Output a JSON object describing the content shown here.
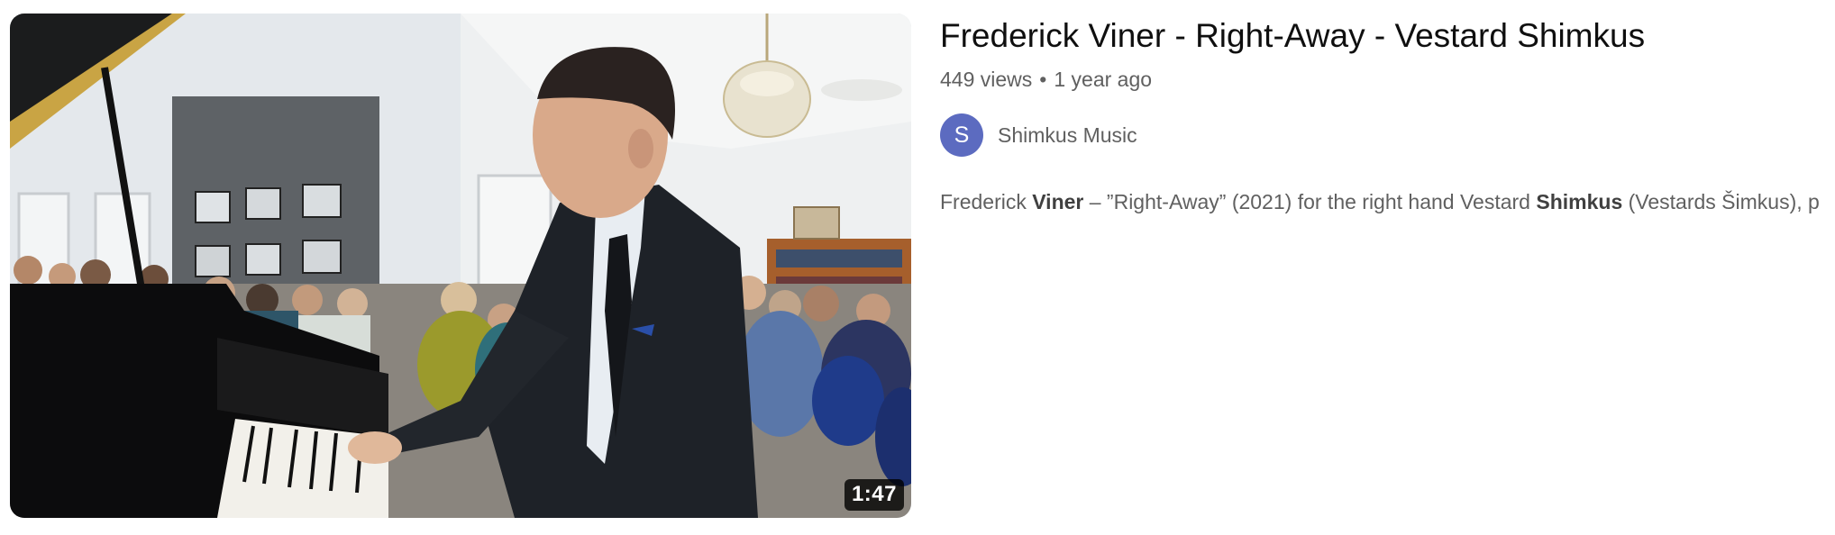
{
  "video": {
    "title": "Frederick Viner - Right-Away - Vestard Shimkus",
    "views": "449 views",
    "separator": "•",
    "age": "1 year ago",
    "duration": "1:47",
    "thumbnail_alt": "Pianist in dark suit playing a grand piano in front of a seated audience"
  },
  "channel": {
    "avatar_letter": "S",
    "avatar_color": "#5c6bc0",
    "name": "Shimkus Music"
  },
  "description": {
    "segments": [
      {
        "text": "Frederick ",
        "bold": false
      },
      {
        "text": "Viner",
        "bold": true
      },
      {
        "text": " – ”Right-Away” (2021) for the right hand Vestard ",
        "bold": false
      },
      {
        "text": "Shimkus",
        "bold": true
      },
      {
        "text": " (Vestards Šimkus), p",
        "bold": false
      }
    ]
  },
  "colors": {
    "title": "#0f0f0f",
    "secondary_text": "#606060",
    "badge_bg": "#000000"
  }
}
